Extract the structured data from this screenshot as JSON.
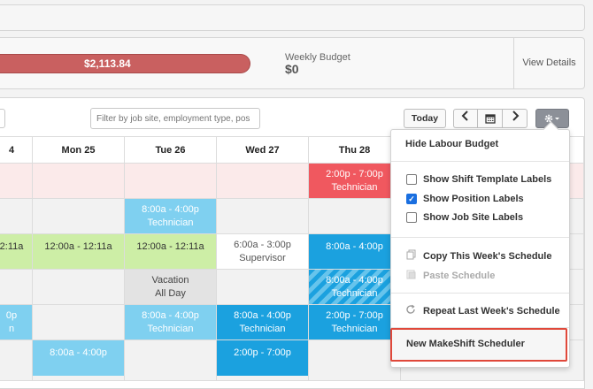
{
  "budget": {
    "amount": "$2,113.84",
    "weekly_label": "Weekly Budget",
    "weekly_value": "$0",
    "view_details": "View Details"
  },
  "toolbar": {
    "filter_placeholder": "Filter by job site, employment type, pos",
    "today": "Today",
    "prev_icon": "‹",
    "calendar_icon": "calendar",
    "next_icon": "›",
    "gear_icon": "gear"
  },
  "days": [
    "4",
    "Mon 25",
    "Tue 26",
    "Wed 27",
    "Thu 28"
  ],
  "shifts": {
    "thu_r1_time": "2:00p - 7:00p",
    "thu_r1_role": "Technician",
    "tue_r2_time": "8:00a - 4:00p",
    "tue_r2_role": "Technician",
    "sun_r3_time": "2:11a",
    "mon_r3_time": "12:00a - 12:11a",
    "tue_r3_time": "12:00a - 12:11a",
    "wed_r3_time": "6:00a - 3:00p",
    "wed_r3_role": "Supervisor",
    "thu_r3_time": "8:00a - 4:00p",
    "tue_r4_time": "Vacation",
    "tue_r4_role": "All Day",
    "thu_r4_time": "8:00a - 4:00p",
    "thu_r4_role": "Technician",
    "sun_r5_time": "0p",
    "sun_r5_role": "n",
    "tue_r5_time": "8:00a - 4:00p",
    "tue_r5_role": "Technician",
    "wed_r5_time": "8:00a - 4:00p",
    "wed_r5_role": "Technician",
    "thu_r5_time": "2:00p - 7:00p",
    "thu_r5_role": "Technician",
    "mon_r6_time": "8:00a - 4:00p",
    "wed_r6_time": "2:00p - 7:00p"
  },
  "menu": {
    "hide_budget": "Hide Labour Budget",
    "show_template": "Show Shift Template Labels",
    "show_position": "Show Position Labels",
    "show_jobsite": "Show Job Site Labels",
    "copy": "Copy This Week's Schedule",
    "paste": "Paste Schedule",
    "repeat": "Repeat Last Week's Schedule",
    "new_scheduler": "New MakeShift Scheduler"
  },
  "colors": {
    "highlight": "#e0483a",
    "budget_bar": "#c96060",
    "shift_blue": "#1ba1df",
    "shift_green": "#cdeea6"
  }
}
